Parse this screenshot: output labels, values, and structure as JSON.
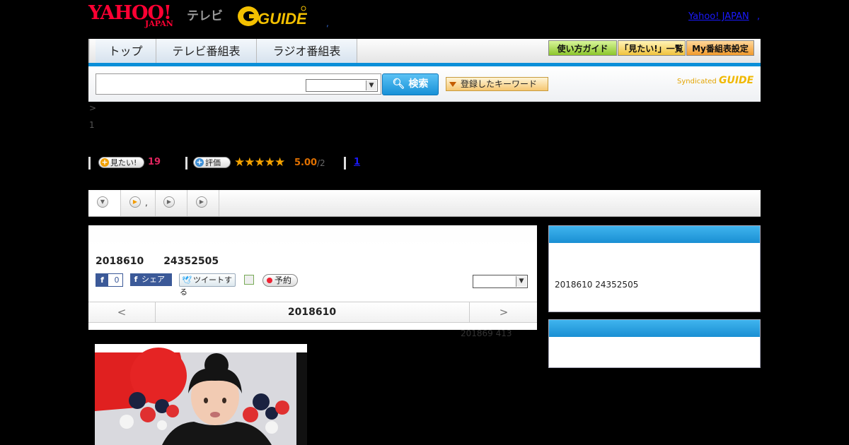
{
  "header": {
    "yahoo_logo": "YAHOO!",
    "japan_logo": "JAPAN",
    "tv_label": "テレビ",
    "gguide_logo": "GUIDE",
    "dot": ",",
    "yahoo_japan_link": "Yahoo! JAPAN",
    "link_dot": ","
  },
  "nav": {
    "tabs": [
      {
        "label": "トップ"
      },
      {
        "label": "テレビ番組表"
      },
      {
        "label": "ラジオ番組表"
      }
    ],
    "tools": [
      {
        "label": "使い方ガイド",
        "color": "#9ad13a"
      },
      {
        "label": "「見たい!」一覧",
        "color": "#f5c94b"
      },
      {
        "label": "My番組表設定",
        "color": "#f5a93a"
      }
    ]
  },
  "search": {
    "input_value": "",
    "select_value": "",
    "button_label": "検索",
    "keyword_button": "登録したキーワード",
    "syndicated": "Syndicated",
    "syndicated_logo": "GUIDE"
  },
  "breadcrumb": ">",
  "page_num": "1",
  "stats": {
    "want_label": "見たい!",
    "want_count": "19",
    "rate_label": "評価",
    "stars": "★★★★★",
    "rating": "5.00",
    "rating_count": "/2",
    "review_link": "1"
  },
  "subtabs": [
    {
      "label": ""
    },
    {
      "label": ","
    },
    {
      "label": ""
    },
    {
      "label": ""
    }
  ],
  "program": {
    "date_line": "2018610　　24352505",
    "fb_count": "0",
    "fb_share": "シェア",
    "tweet": "ツイートする",
    "reserve": "予約",
    "channel_select": "",
    "pager_prev": "<",
    "pager_title": "2018610",
    "pager_next": ">",
    "updated": "201869  413"
  },
  "sidebar": {
    "box1_text": "2018610  24352505",
    "box2_text": ""
  },
  "colors": {
    "accent_blue": "#0a8fd8",
    "yahoo_red": "#ff0033",
    "want_count": "#e0245e",
    "rating": "#e07000"
  }
}
